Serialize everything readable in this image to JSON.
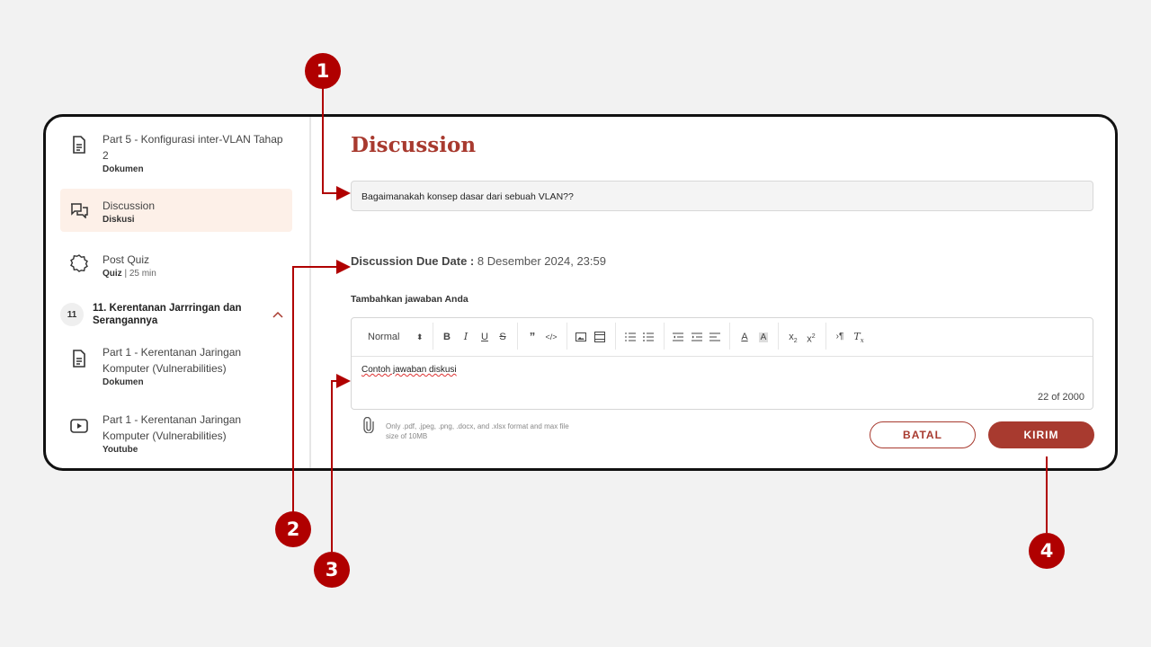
{
  "sidebar": {
    "items": [
      {
        "title": "Part 5 - Konfigurasi inter-VLAN Tahap 2",
        "sub": "Dokumen",
        "icon": "document-icon"
      },
      {
        "title": "Discussion",
        "sub": "Diskusi",
        "icon": "discussion-icon"
      },
      {
        "title": "Post Quiz",
        "sub": "Quiz",
        "sub_extra": " | 25 min",
        "icon": "quiz-badge-icon"
      },
      {
        "title": "Part 1 - Kerentanan Jaringan Komputer (Vulnerabilities)",
        "sub": "Dokumen",
        "icon": "document-icon"
      },
      {
        "title": "Part 1 - Kerentanan Jaringan Komputer (Vulnerabilities)",
        "sub": "Youtube",
        "icon": "video-icon"
      }
    ],
    "section": {
      "number": "11",
      "title": "11. Kerentanan Jarrringan dan Serangannya"
    }
  },
  "main": {
    "title": "Discussion",
    "question": "Bagaimanakah konsep dasar dari sebuah VLAN??",
    "due_label": "Discussion Due Date :",
    "due_value": " 8 Desember 2024, 23:59",
    "add_label": "Tambahkan jawaban Anda",
    "editor": {
      "format": "Normal",
      "content": "Contoh jawaban diskusi",
      "counter": "22 of 2000"
    },
    "attach_hint": "Only .pdf, .jpeg, .png, .docx, and .xlsx format and max file size of 10MB",
    "cancel_label": "BATAL",
    "send_label": "KIRIM"
  },
  "callouts": [
    "1",
    "2",
    "3",
    "4"
  ],
  "colors": {
    "accent": "#a83a2f",
    "callout": "#b00000",
    "active_bg": "#fdf0e8"
  }
}
